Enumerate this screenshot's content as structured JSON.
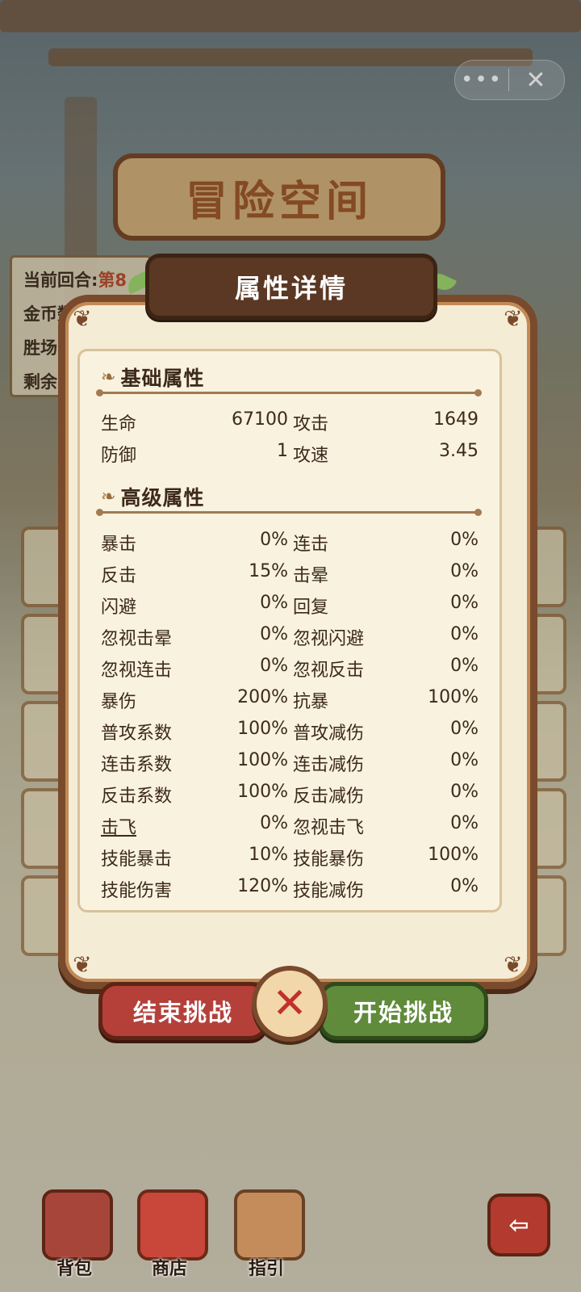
{
  "top_bar": {
    "more_label": "•••",
    "close_label": "✕"
  },
  "background": {
    "banner_title": "冒险空间",
    "info_card": {
      "round_label": "当前回合:",
      "round_value": "第8",
      "coins_label": "金币数:",
      "wins_label": "胜场",
      "remain_label": "剩余"
    }
  },
  "modal": {
    "title": "属性详情",
    "sections": [
      {
        "title": "基础属性",
        "rows": [
          {
            "k1": "生命",
            "v1": "67100",
            "k2": "攻击",
            "v2": "1649"
          },
          {
            "k1": "防御",
            "v1": "1",
            "k2": "攻速",
            "v2": "3.45"
          }
        ]
      },
      {
        "title": "高级属性",
        "rows": [
          {
            "k1": "暴击",
            "v1": "0%",
            "k2": "连击",
            "v2": "0%"
          },
          {
            "k1": "反击",
            "v1": "15%",
            "k2": "击晕",
            "v2": "0%"
          },
          {
            "k1": "闪避",
            "v1": "0%",
            "k2": "回复",
            "v2": "0%"
          },
          {
            "k1": "忽视击晕",
            "v1": "0%",
            "k2": "忽视闪避",
            "v2": "0%"
          },
          {
            "k1": "忽视连击",
            "v1": "0%",
            "k2": "忽视反击",
            "v2": "0%"
          },
          {
            "k1": "暴伤",
            "v1": "200%",
            "k2": "抗暴",
            "v2": "100%"
          },
          {
            "k1": "普攻系数",
            "v1": "100%",
            "k2": "普攻减伤",
            "v2": "0%"
          },
          {
            "k1": "连击系数",
            "v1": "100%",
            "k2": "连击减伤",
            "v2": "0%"
          },
          {
            "k1": "反击系数",
            "v1": "100%",
            "k2": "反击减伤",
            "v2": "0%"
          },
          {
            "k1": "击飞",
            "v1": "0%",
            "k2": "忽视击飞",
            "v2": "0%"
          },
          {
            "k1": "技能暴击",
            "v1": "10%",
            "k2": "技能暴伤",
            "v2": "100%"
          },
          {
            "k1": "技能伤害",
            "v1": "120%",
            "k2": "技能减伤",
            "v2": "0%"
          }
        ]
      }
    ]
  },
  "buttons": {
    "end_label": "结束挑战",
    "start_label": "开始挑战",
    "close_symbol": "✕"
  },
  "bottom_nav": {
    "bag_label": "背包",
    "shop_label": "商店",
    "guide_label": "指引",
    "exit_symbol": "⇦"
  },
  "colors": {
    "frame": "#7a4a2c",
    "panel": "#f5ecd6",
    "end_button": "#b5403a",
    "start_button": "#5f8b3b"
  }
}
